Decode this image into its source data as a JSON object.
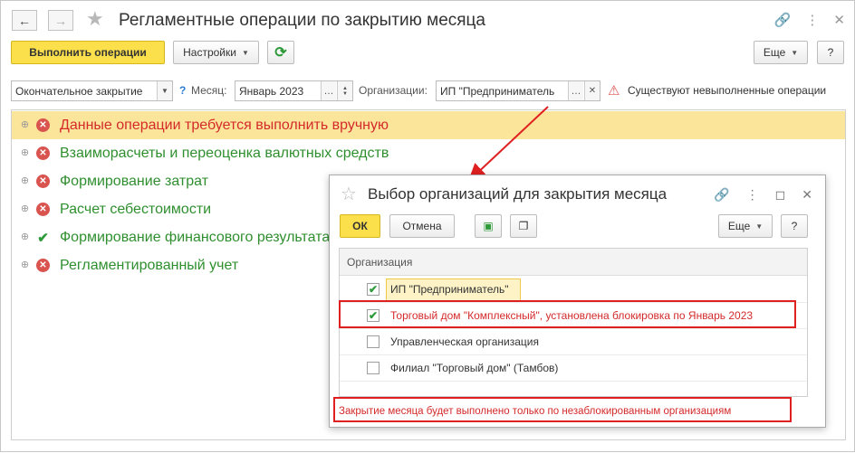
{
  "window": {
    "title": "Регламентные операции по закрытию месяца"
  },
  "toolbar": {
    "run_label": "Выполнить операции",
    "settings_label": "Настройки",
    "more_label": "Еще",
    "help_label": "?"
  },
  "filters": {
    "closing_type": "Окончательное закрытие",
    "month_label": "Месяц:",
    "month_value": "Январь 2023",
    "org_label": "Организации:",
    "org_value": "ИП \"Предприниматель",
    "help_mark": "?",
    "warning_text": "Существуют невыполненные операции"
  },
  "operations": [
    {
      "label": "Данные операции требуется выполнить вручную",
      "status": "error",
      "color": "#d42a2a",
      "selected": true
    },
    {
      "label": "Взаиморасчеты и переоценка валютных средств",
      "status": "error",
      "color": "#2f8f2f"
    },
    {
      "label": "Формирование затрат",
      "status": "error",
      "color": "#2f8f2f"
    },
    {
      "label": "Расчет себестоимости",
      "status": "error",
      "color": "#2f8f2f"
    },
    {
      "label": "Формирование финансового результата",
      "status": "ok",
      "color": "#2f8f2f"
    },
    {
      "label": "Регламентированный учет",
      "status": "error",
      "color": "#2f8f2f"
    }
  ],
  "dialog": {
    "title": "Выбор организаций для закрытия месяца",
    "ok_label": "ОК",
    "cancel_label": "Отмена",
    "more_label": "Еще",
    "help_label": "?",
    "column_header": "Организация",
    "rows": [
      {
        "name": "ИП \"Предприниматель\"",
        "checked": true,
        "color": "#333333"
      },
      {
        "name": "Торговый дом \"Комплексный\",  установлена блокировка по Январь 2023",
        "checked": true,
        "color": "#d42a2a"
      },
      {
        "name": "Управленческая организация",
        "checked": false,
        "color": "#333333"
      },
      {
        "name": "Филиал \"Торговый дом\" (Тамбов)",
        "checked": false,
        "color": "#333333"
      }
    ],
    "footer_note": "Закрытие месяца будет выполнено только по незаблокированным организациям"
  },
  "colors": {
    "accent_yellow": "#fbe04c",
    "selection": "#fbe59b",
    "annotation_red": "#e02020"
  }
}
